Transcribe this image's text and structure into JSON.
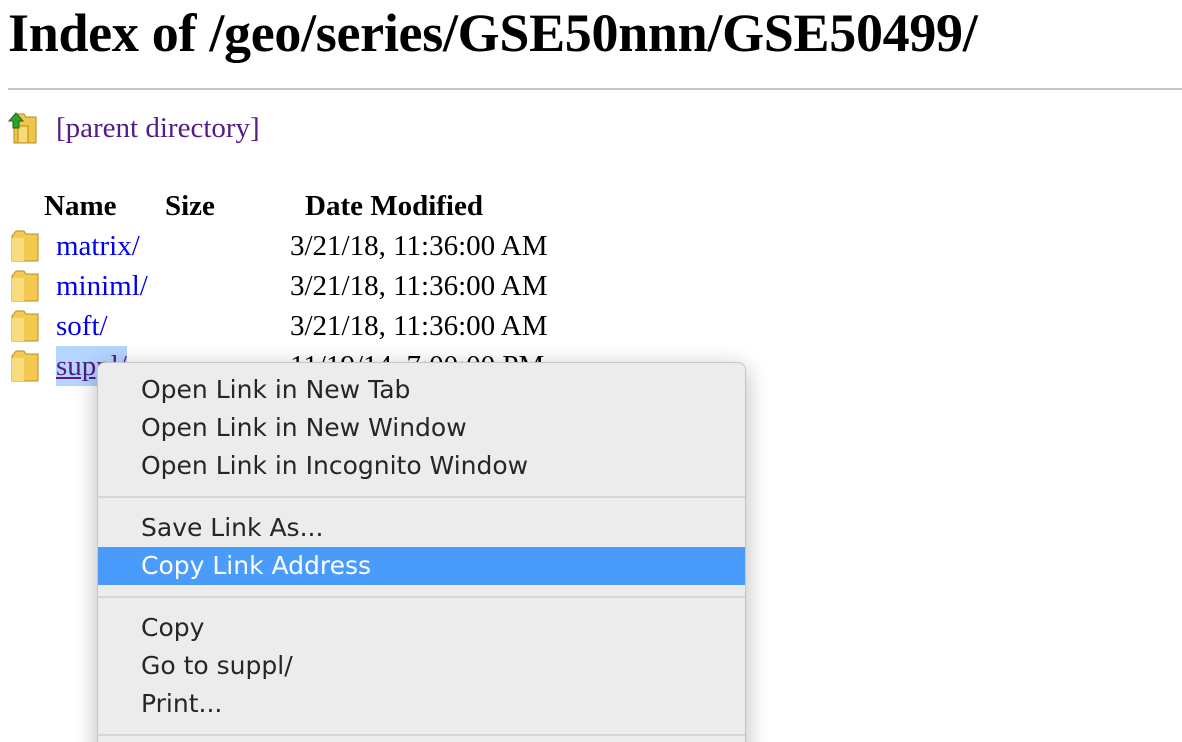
{
  "page": {
    "title": "Index of /geo/series/GSE50nnn/GSE50499/",
    "parent_link": "[parent directory]"
  },
  "table": {
    "headers": {
      "name": "Name",
      "size": "Size",
      "date": "Date Modified"
    },
    "rows": [
      {
        "name": "matrix/",
        "size": "",
        "date": "3/21/18, 11:36:00 AM",
        "icon": "folder-icon"
      },
      {
        "name": "miniml/",
        "size": "",
        "date": "3/21/18, 11:36:00 AM",
        "icon": "folder-icon"
      },
      {
        "name": "soft/",
        "size": "",
        "date": "3/21/18, 11:36:00 AM",
        "icon": "folder-icon"
      },
      {
        "name": "suppl/",
        "size": "",
        "date": "11/19/14, 7:00:00 PM",
        "icon": "folder-icon"
      }
    ]
  },
  "context_menu": {
    "groups": [
      [
        "Open Link in New Tab",
        "Open Link in New Window",
        "Open Link in Incognito Window"
      ],
      [
        "Save Link As...",
        "Copy Link Address"
      ],
      [
        "Copy",
        "Go to suppl/",
        "Print..."
      ]
    ],
    "highlighted": "Copy Link Address"
  },
  "colors": {
    "link": "#0000ee",
    "visited_link": "#551a8b",
    "menu_highlight": "#4a9cfa",
    "selection": "#b4d5fe",
    "folder": "#f3c94f"
  }
}
